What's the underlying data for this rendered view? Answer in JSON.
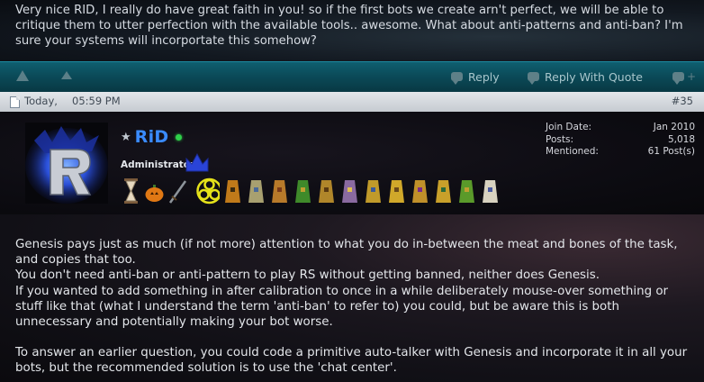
{
  "previous_post": {
    "text": "Very nice RID, I really do have great faith in you! so if the first bots we create arn't perfect, we will be able to critique them to utter perfection with the available tools.. awesome. What about anti-patterns and anti-ban? I'm sure your systems will incorportate this somehow?"
  },
  "actions": {
    "reply_label": "Reply",
    "quote_label": "Reply With Quote"
  },
  "post": {
    "date": "Today,",
    "time": "05:59 PM",
    "number": "#35",
    "author": {
      "username": "RiD",
      "title": "Administrator",
      "online": true
    },
    "stats": {
      "join_date_label": "Join Date:",
      "join_date": "Jan 2010",
      "posts_label": "Posts:",
      "posts": "5,018",
      "mentioned_label": "Mentioned:",
      "mentioned": "61 Post(s)"
    },
    "awards": [
      "hourglass-icon",
      "pumpkin-icon",
      "sword-icon",
      "biohazard-icon",
      "cape-1-icon",
      "cape-2-icon",
      "cape-3-icon",
      "cape-4-icon",
      "cape-5-icon",
      "cape-6-icon",
      "cape-7-icon",
      "cape-8-icon",
      "cape-9-icon",
      "cape-10-icon",
      "cape-11-icon",
      "cape-12-icon"
    ],
    "body": {
      "p1": "Genesis pays just as much (if not more) attention to what you do in-between the meat and bones of the task, and copies that too.",
      "p2": "You don't need anti-ban or anti-pattern to play RS without getting banned, neither does Genesis.",
      "p3": "If you wanted to add something in after calibration to once in a while deliberately mouse-over something or stuff like that (what I understand the term 'anti-ban' to refer to) you could, but be aware this is both unnecessary and potentially making your bot worse.",
      "p4": "To answer an earlier question, you could code a primitive auto-talker with Genesis and incorporate it in all your bots, but the recommended solution is to use the 'chat center'."
    }
  },
  "colors": {
    "username": "#3a8bff",
    "action_bar": "#0b4b59",
    "online": "#2fd04a"
  }
}
